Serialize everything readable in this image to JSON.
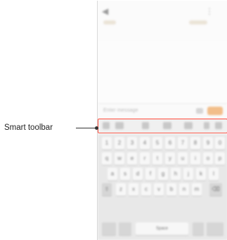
{
  "callout": {
    "label": "Smart toolbar"
  },
  "screen": {
    "compose_placeholder": "Enter message",
    "icons": {
      "back": "back-arrow-icon",
      "menu": "menu-icon",
      "attach": "attach-icon"
    },
    "send_label": "",
    "keyboard": {
      "rows": [
        [
          "1",
          "2",
          "3",
          "4",
          "5",
          "6",
          "7",
          "8",
          "9",
          "0"
        ],
        [
          "q",
          "w",
          "e",
          "r",
          "t",
          "y",
          "u",
          "i",
          "o",
          "p"
        ],
        [
          "a",
          "s",
          "d",
          "f",
          "g",
          "h",
          "j",
          "k",
          "l"
        ],
        [
          "z",
          "x",
          "c",
          "v",
          "b",
          "n",
          "m"
        ]
      ],
      "space_label": "Space"
    }
  },
  "colors": {
    "highlight": "#ff4a3a",
    "send": "#f2be8a"
  }
}
